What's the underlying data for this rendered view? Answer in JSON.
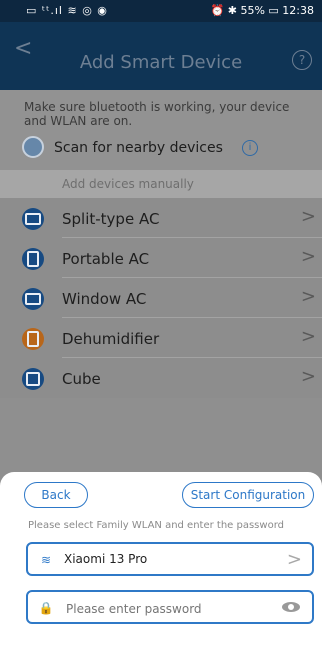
{
  "status": {
    "left": "▭ ᵗᵗ.ıl ≋ ◎ ◉",
    "right": "⏰ ✱ 55% ▭ 12:38"
  },
  "header": {
    "title": "Add Smart Device",
    "help_icon": "?"
  },
  "info": {
    "message": "Make sure bluetooth is working, your device and WLAN are on.",
    "scan_label": "Scan for nearby devices"
  },
  "manual": {
    "header": "Add devices manually"
  },
  "devices": [
    {
      "label": "Split-type AC",
      "color": "#174a82"
    },
    {
      "label": "Portable AC",
      "color": "#174a82"
    },
    {
      "label": "Window AC",
      "color": "#174a82"
    },
    {
      "label": "Dehumidifier",
      "color": "#b8661a"
    },
    {
      "label": "Cube",
      "color": "#174a82"
    }
  ],
  "sheet": {
    "back_label": "Back",
    "start_label": "Start Configuration",
    "hint": "Please select Family WLAN and enter the password",
    "wifi_name": "Xiaomi 13 Pro",
    "password_placeholder": "Please enter password"
  }
}
